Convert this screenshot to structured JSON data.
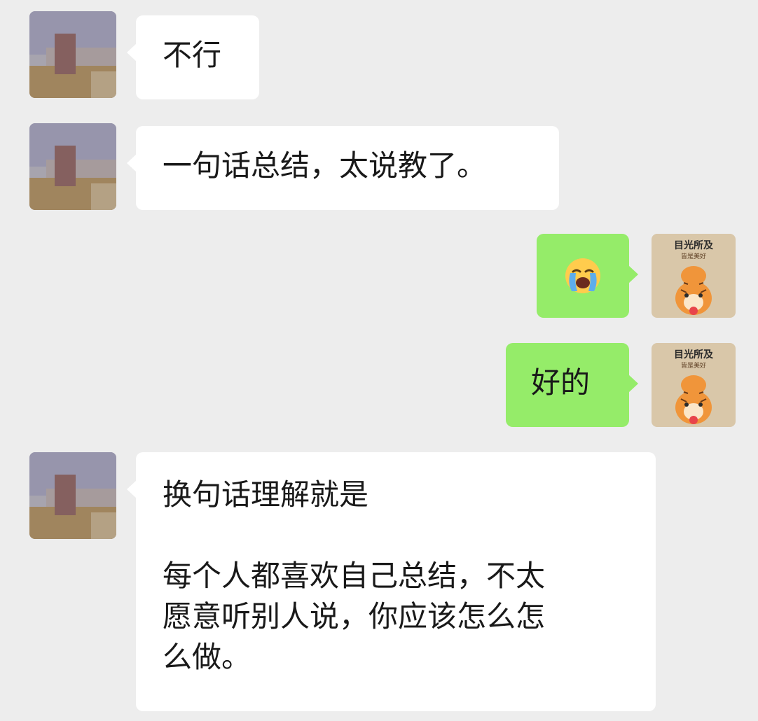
{
  "colors": {
    "background": "#ededed",
    "incoming_bubble": "#ffffff",
    "outgoing_bubble": "#95ec69"
  },
  "messages": [
    {
      "side": "incoming",
      "text": "不行"
    },
    {
      "side": "incoming",
      "text": "一句话总结，太说教了。"
    },
    {
      "side": "outgoing",
      "emoji": "loudly-crying-face-emoji"
    },
    {
      "side": "outgoing",
      "text": "好的"
    },
    {
      "side": "incoming",
      "lines": [
        "换句话理解就是",
        "",
        "每个人都喜欢自己总结，不太",
        "愿意听别人说，你应该怎么怎",
        "么做。"
      ]
    }
  ],
  "my_avatar": {
    "caption_line1": "目光所及",
    "caption_line2": "皆是美好"
  }
}
